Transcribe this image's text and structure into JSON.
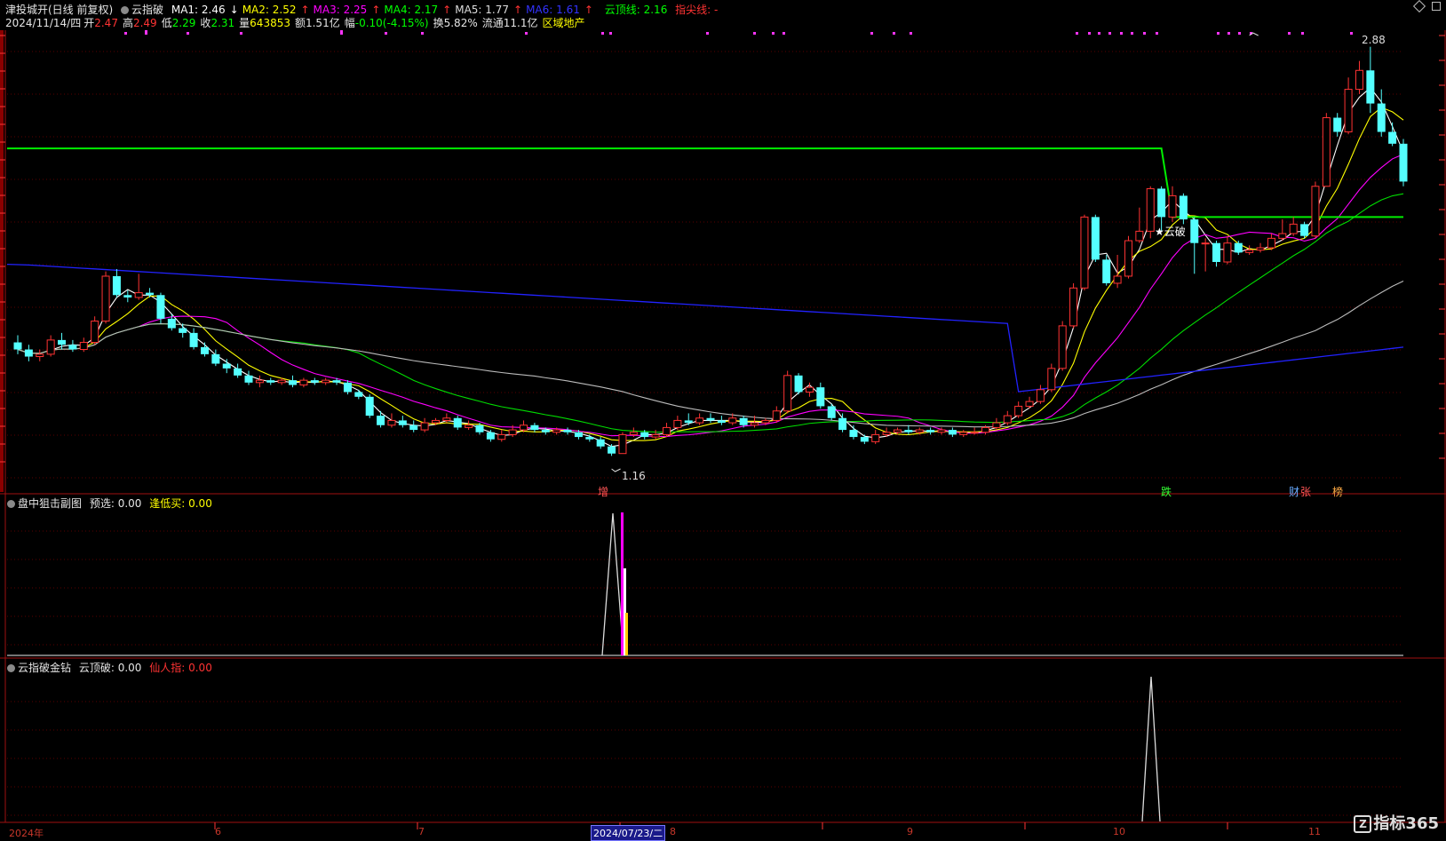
{
  "header": {
    "stock_title": "津投城开(日线 前复权)",
    "indicator_name": "云指破",
    "ma": [
      {
        "label": "MA1: 2.46",
        "arrow": "↓",
        "color": "#ffffff",
        "arrow_color": "#ffffff"
      },
      {
        "label": "MA2: 2.52",
        "arrow": "↑",
        "color": "#ffff00",
        "arrow_color": "#ff3333"
      },
      {
        "label": "MA3: 2.25",
        "arrow": "↑",
        "color": "#ff00ff",
        "arrow_color": "#ff3333"
      },
      {
        "label": "MA4: 2.17",
        "arrow": "↑",
        "color": "#00ff00",
        "arrow_color": "#ff3333"
      },
      {
        "label": "MA5: 1.77",
        "arrow": "↑",
        "color": "#dddddd",
        "arrow_color": "#ff3333"
      },
      {
        "label": "MA6: 1.61",
        "arrow": "↑",
        "color": "#3333ff",
        "arrow_color": "#ff3333"
      }
    ],
    "cloud_line": "云顶线: 2.16",
    "tip_line": "指尖线: -",
    "date": "2024/11/14/四",
    "open_label": "开",
    "open_val": "2.47",
    "high_label": "高",
    "high_val": "2.49",
    "low_label": "低",
    "low_val": "2.29",
    "close_label": "收",
    "close_val": "2.31",
    "vol_label": "量",
    "vol_val": "643853",
    "amount": "额1.51亿",
    "change_label": "幅",
    "change_val": "-0.10(-4.15%)",
    "turnover": "换5.82%",
    "float_cap": "流通11.1亿",
    "sector": "区域地产"
  },
  "main_chart": {
    "price_high_label": "2.88",
    "price_low_label": "1.16",
    "marker_text": "★云破",
    "tags": [
      {
        "text": "增",
        "color": "#ff5555"
      },
      {
        "text": "跌",
        "color": "#33ff33"
      },
      {
        "text": "财",
        "color": "#66aaff"
      },
      {
        "text": "张",
        "color": "#ff5555"
      },
      {
        "text": "榜",
        "color": "#ffaa44"
      }
    ]
  },
  "panel2": {
    "name": "盘中狙击副图",
    "field1": "预选: 0.00",
    "field2": "逢低买: 0.00"
  },
  "panel3": {
    "name": "云指破金钻",
    "field1": "云顶破: 0.00",
    "field2": "仙人指: 0.00"
  },
  "x_axis": {
    "labels": [
      "2024年",
      "6",
      "7",
      "2024/07/23/二",
      "8",
      "9",
      "10",
      "11"
    ]
  },
  "logo": {
    "text": "指标365",
    "mark": "Z"
  },
  "chart_data": {
    "type": "candlestick",
    "series_names": [
      "MA1",
      "MA2",
      "MA3",
      "MA4",
      "MA5",
      "MA6",
      "云顶线"
    ],
    "candles": [
      [
        1.63,
        1.6,
        1.66,
        1.58
      ],
      [
        1.6,
        1.57,
        1.62,
        1.55
      ],
      [
        1.57,
        1.58,
        1.6,
        1.55
      ],
      [
        1.58,
        1.64,
        1.66,
        1.57
      ],
      [
        1.64,
        1.62,
        1.67,
        1.6
      ],
      [
        1.62,
        1.6,
        1.64,
        1.59
      ],
      [
        1.6,
        1.63,
        1.65,
        1.59
      ],
      [
        1.63,
        1.72,
        1.74,
        1.62
      ],
      [
        1.72,
        1.91,
        1.93,
        1.71
      ],
      [
        1.91,
        1.83,
        1.94,
        1.82
      ],
      [
        1.83,
        1.82,
        1.85,
        1.8
      ],
      [
        1.82,
        1.84,
        1.92,
        1.81
      ],
      [
        1.84,
        1.83,
        1.86,
        1.82
      ],
      [
        1.83,
        1.73,
        1.84,
        1.71
      ],
      [
        1.73,
        1.69,
        1.75,
        1.68
      ],
      [
        1.69,
        1.67,
        1.71,
        1.65
      ],
      [
        1.67,
        1.61,
        1.69,
        1.6
      ],
      [
        1.61,
        1.58,
        1.63,
        1.57
      ],
      [
        1.58,
        1.54,
        1.6,
        1.53
      ],
      [
        1.54,
        1.52,
        1.56,
        1.5
      ],
      [
        1.52,
        1.49,
        1.54,
        1.48
      ],
      [
        1.49,
        1.46,
        1.51,
        1.45
      ],
      [
        1.46,
        1.47,
        1.49,
        1.44
      ],
      [
        1.47,
        1.46,
        1.48,
        1.45
      ],
      [
        1.46,
        1.47,
        1.48,
        1.45
      ],
      [
        1.47,
        1.45,
        1.49,
        1.44
      ],
      [
        1.45,
        1.47,
        1.48,
        1.44
      ],
      [
        1.47,
        1.46,
        1.48,
        1.45
      ],
      [
        1.46,
        1.47,
        1.48,
        1.45
      ],
      [
        1.47,
        1.46,
        1.48,
        1.45
      ],
      [
        1.46,
        1.42,
        1.47,
        1.41
      ],
      [
        1.42,
        1.4,
        1.43,
        1.39
      ],
      [
        1.4,
        1.32,
        1.41,
        1.31
      ],
      [
        1.32,
        1.28,
        1.34,
        1.27
      ],
      [
        1.28,
        1.3,
        1.33,
        1.27
      ],
      [
        1.3,
        1.28,
        1.32,
        1.27
      ],
      [
        1.28,
        1.26,
        1.3,
        1.25
      ],
      [
        1.26,
        1.29,
        1.31,
        1.25
      ],
      [
        1.29,
        1.3,
        1.31,
        1.28
      ],
      [
        1.3,
        1.31,
        1.33,
        1.29
      ],
      [
        1.31,
        1.27,
        1.32,
        1.26
      ],
      [
        1.27,
        1.28,
        1.3,
        1.26
      ],
      [
        1.28,
        1.25,
        1.29,
        1.24
      ],
      [
        1.25,
        1.22,
        1.26,
        1.21
      ],
      [
        1.22,
        1.24,
        1.26,
        1.21
      ],
      [
        1.24,
        1.26,
        1.28,
        1.23
      ],
      [
        1.26,
        1.28,
        1.3,
        1.25
      ],
      [
        1.28,
        1.26,
        1.29,
        1.25
      ],
      [
        1.26,
        1.25,
        1.27,
        1.24
      ],
      [
        1.25,
        1.26,
        1.27,
        1.24
      ],
      [
        1.26,
        1.25,
        1.27,
        1.24
      ],
      [
        1.25,
        1.23,
        1.26,
        1.22
      ],
      [
        1.23,
        1.22,
        1.24,
        1.21
      ],
      [
        1.22,
        1.19,
        1.23,
        1.18
      ],
      [
        1.19,
        1.16,
        1.2,
        1.15
      ],
      [
        1.16,
        1.24,
        1.25,
        1.16
      ],
      [
        1.24,
        1.25,
        1.27,
        1.23
      ],
      [
        1.25,
        1.23,
        1.26,
        1.22
      ],
      [
        1.23,
        1.24,
        1.26,
        1.22
      ],
      [
        1.24,
        1.27,
        1.29,
        1.23
      ],
      [
        1.27,
        1.3,
        1.32,
        1.26
      ],
      [
        1.3,
        1.29,
        1.33,
        1.28
      ],
      [
        1.29,
        1.31,
        1.33,
        1.28
      ],
      [
        1.31,
        1.3,
        1.33,
        1.29
      ],
      [
        1.3,
        1.29,
        1.32,
        1.28
      ],
      [
        1.29,
        1.31,
        1.33,
        1.28
      ],
      [
        1.31,
        1.28,
        1.32,
        1.27
      ],
      [
        1.28,
        1.29,
        1.32,
        1.27
      ],
      [
        1.29,
        1.3,
        1.31,
        1.28
      ],
      [
        1.3,
        1.34,
        1.36,
        1.29
      ],
      [
        1.34,
        1.49,
        1.51,
        1.33
      ],
      [
        1.49,
        1.42,
        1.5,
        1.41
      ],
      [
        1.42,
        1.44,
        1.46,
        1.4
      ],
      [
        1.44,
        1.36,
        1.46,
        1.35
      ],
      [
        1.36,
        1.31,
        1.37,
        1.3
      ],
      [
        1.31,
        1.26,
        1.33,
        1.25
      ],
      [
        1.26,
        1.23,
        1.28,
        1.22
      ],
      [
        1.23,
        1.21,
        1.24,
        1.2
      ],
      [
        1.21,
        1.24,
        1.26,
        1.2
      ],
      [
        1.24,
        1.25,
        1.27,
        1.23
      ],
      [
        1.25,
        1.26,
        1.27,
        1.24
      ],
      [
        1.26,
        1.25,
        1.28,
        1.24
      ],
      [
        1.25,
        1.26,
        1.27,
        1.24
      ],
      [
        1.26,
        1.25,
        1.27,
        1.24
      ],
      [
        1.25,
        1.26,
        1.27,
        1.24
      ],
      [
        1.26,
        1.24,
        1.27,
        1.23
      ],
      [
        1.24,
        1.25,
        1.26,
        1.23
      ],
      [
        1.25,
        1.25,
        1.27,
        1.24
      ],
      [
        1.25,
        1.27,
        1.28,
        1.24
      ],
      [
        1.27,
        1.29,
        1.31,
        1.26
      ],
      [
        1.29,
        1.32,
        1.34,
        1.28
      ],
      [
        1.32,
        1.36,
        1.38,
        1.31
      ],
      [
        1.36,
        1.38,
        1.4,
        1.35
      ],
      [
        1.38,
        1.43,
        1.45,
        1.37
      ],
      [
        1.43,
        1.52,
        1.54,
        1.42
      ],
      [
        1.52,
        1.7,
        1.72,
        1.51
      ],
      [
        1.7,
        1.86,
        1.88,
        1.69
      ],
      [
        1.86,
        2.16,
        2.17,
        1.85
      ],
      [
        2.16,
        1.98,
        2.17,
        1.97
      ],
      [
        1.98,
        1.88,
        2.0,
        1.87
      ],
      [
        1.88,
        1.91,
        2.0,
        1.86
      ],
      [
        1.91,
        2.06,
        2.08,
        1.9
      ],
      [
        2.06,
        2.1,
        2.2,
        2.05
      ],
      [
        2.1,
        2.28,
        2.29,
        2.07
      ],
      [
        2.28,
        2.16,
        2.29,
        2.1
      ],
      [
        2.16,
        2.25,
        2.29,
        2.14
      ],
      [
        2.25,
        2.15,
        2.26,
        2.13
      ],
      [
        2.15,
        2.05,
        2.16,
        1.92
      ],
      [
        2.05,
        2.05,
        2.07,
        1.93
      ],
      [
        2.05,
        1.97,
        2.06,
        1.95
      ],
      [
        1.97,
        2.05,
        2.08,
        1.96
      ],
      [
        2.05,
        2.01,
        2.06,
        2.0
      ],
      [
        2.01,
        2.02,
        2.04,
        2.0
      ],
      [
        2.02,
        2.03,
        2.05,
        2.01
      ],
      [
        2.03,
        2.07,
        2.09,
        2.02
      ],
      [
        2.07,
        2.09,
        2.15,
        2.06
      ],
      [
        2.09,
        2.13,
        2.16,
        2.08
      ],
      [
        2.13,
        2.08,
        2.14,
        2.07
      ],
      [
        2.08,
        2.29,
        2.31,
        2.07
      ],
      [
        2.29,
        2.58,
        2.6,
        2.43
      ],
      [
        2.58,
        2.52,
        2.6,
        2.5
      ],
      [
        2.52,
        2.7,
        2.75,
        2.51
      ],
      [
        2.7,
        2.78,
        2.82,
        2.68
      ],
      [
        2.78,
        2.64,
        2.88,
        2.6
      ],
      [
        2.64,
        2.52,
        2.7,
        2.5
      ],
      [
        2.52,
        2.47,
        2.56,
        2.46
      ],
      [
        2.47,
        2.31,
        2.49,
        2.29
      ]
    ]
  }
}
